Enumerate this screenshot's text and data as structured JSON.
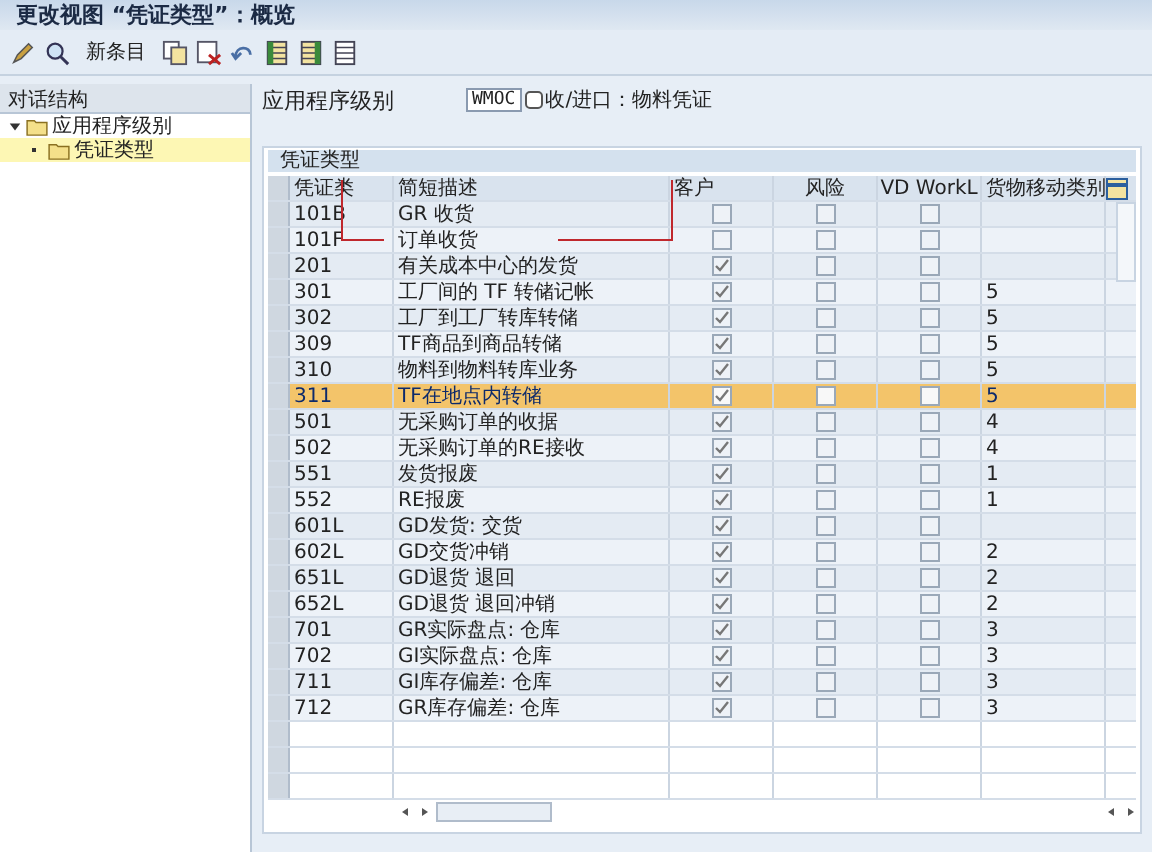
{
  "window": {
    "title": "更改视图 “凭证类型”：概览"
  },
  "toolbar": {
    "new_entries": "新条目"
  },
  "sidebar": {
    "title": "对话结构",
    "tree": [
      {
        "label": "应用程序级别",
        "expanded": true,
        "selected": false,
        "children": [
          {
            "label": "凭证类型",
            "selected": true
          }
        ]
      }
    ]
  },
  "field": {
    "label": "应用程序级别",
    "value": "WMOC",
    "description": "收/进口：物料凭证"
  },
  "table": {
    "title": "凭证类型",
    "columns": [
      "凭证类",
      "简短描述",
      "客户",
      "风险",
      "VD WorkL",
      "货物移动类别"
    ],
    "rows": [
      {
        "code": "101B",
        "desc": "GR 收货",
        "customer": false,
        "risk": false,
        "vd": false,
        "category": "",
        "selected": false
      },
      {
        "code": "101F",
        "desc": "订单收货",
        "customer": false,
        "risk": false,
        "vd": false,
        "category": "",
        "selected": false
      },
      {
        "code": "201",
        "desc": "有关成本中心的发货",
        "customer": true,
        "risk": false,
        "vd": false,
        "category": "",
        "selected": false
      },
      {
        "code": "301",
        "desc": "工厂间的 TF 转储记帐",
        "customer": true,
        "risk": false,
        "vd": false,
        "category": "5",
        "selected": false
      },
      {
        "code": "302",
        "desc": "工厂到工厂转库转储",
        "customer": true,
        "risk": false,
        "vd": false,
        "category": "5",
        "selected": false
      },
      {
        "code": "309",
        "desc": "TF商品到商品转储",
        "customer": true,
        "risk": false,
        "vd": false,
        "category": "5",
        "selected": false
      },
      {
        "code": "310",
        "desc": "物料到物料转库业务",
        "customer": true,
        "risk": false,
        "vd": false,
        "category": "5",
        "selected": false
      },
      {
        "code": "311",
        "desc": "TF在地点内转储",
        "customer": true,
        "risk": false,
        "vd": false,
        "category": "5",
        "selected": true
      },
      {
        "code": "501",
        "desc": "无采购订单的收据",
        "customer": true,
        "risk": false,
        "vd": false,
        "category": "4",
        "selected": false
      },
      {
        "code": "502",
        "desc": "无采购订单的RE接收",
        "customer": true,
        "risk": false,
        "vd": false,
        "category": "4",
        "selected": false
      },
      {
        "code": "551",
        "desc": "发货报废",
        "customer": true,
        "risk": false,
        "vd": false,
        "category": "1",
        "selected": false
      },
      {
        "code": "552",
        "desc": "RE报废",
        "customer": true,
        "risk": false,
        "vd": false,
        "category": "1",
        "selected": false
      },
      {
        "code": "601L",
        "desc": "GD发货: 交货",
        "customer": true,
        "risk": false,
        "vd": false,
        "category": "",
        "selected": false
      },
      {
        "code": "602L",
        "desc": "GD交货冲销",
        "customer": true,
        "risk": false,
        "vd": false,
        "category": "2",
        "selected": false
      },
      {
        "code": "651L",
        "desc": "GD退货  退回",
        "customer": true,
        "risk": false,
        "vd": false,
        "category": "2",
        "selected": false
      },
      {
        "code": "652L",
        "desc": "GD退货  退回冲销",
        "customer": true,
        "risk": false,
        "vd": false,
        "category": "2",
        "selected": false
      },
      {
        "code": "701",
        "desc": "GR实际盘点: 仓库",
        "customer": true,
        "risk": false,
        "vd": false,
        "category": "3",
        "selected": false
      },
      {
        "code": "702",
        "desc": "GI实际盘点: 仓库",
        "customer": true,
        "risk": false,
        "vd": false,
        "category": "3",
        "selected": false
      },
      {
        "code": "711",
        "desc": "GI库存偏差: 仓库",
        "customer": true,
        "risk": false,
        "vd": false,
        "category": "3",
        "selected": false
      },
      {
        "code": "712",
        "desc": "GR库存偏差: 仓库",
        "customer": true,
        "risk": false,
        "vd": false,
        "category": "3",
        "selected": false
      }
    ]
  }
}
